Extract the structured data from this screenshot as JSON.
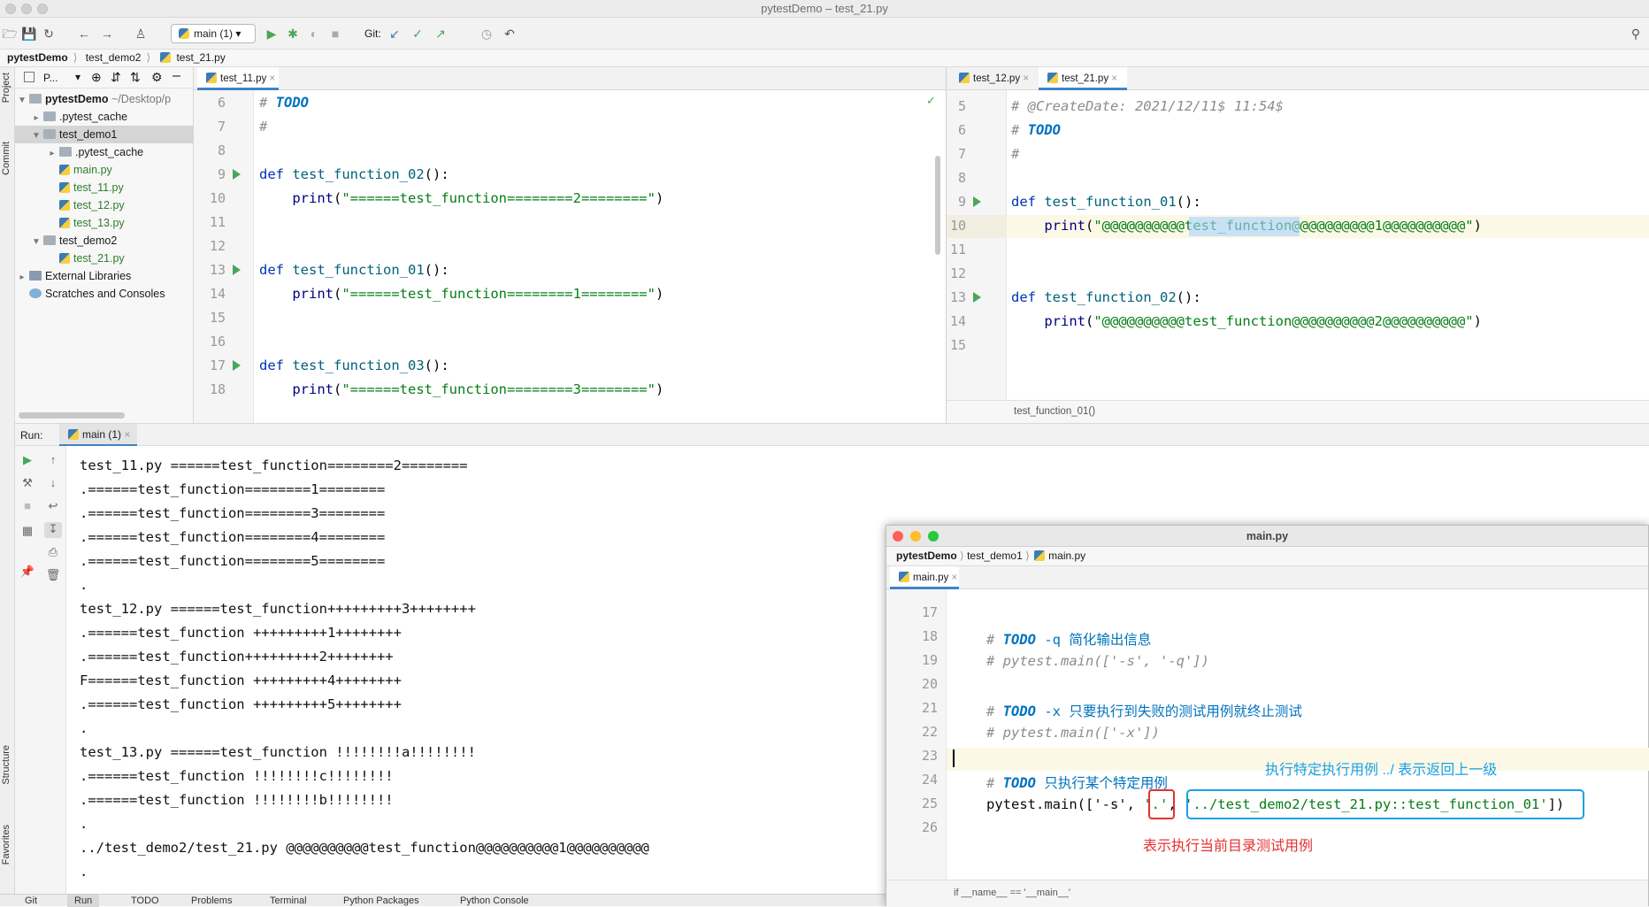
{
  "window": {
    "title": "pytestDemo – test_21.py"
  },
  "toolbar": {
    "run_config": "main (1)",
    "git_label": "Git:"
  },
  "breadcrumb": [
    "pytestDemo",
    "test_demo2",
    "test_21.py"
  ],
  "left_strip": {
    "project": "Project",
    "commit": "Commit",
    "structure": "Structure",
    "favorites": "Favorites"
  },
  "project": {
    "header": "P...",
    "tree": [
      {
        "label": "pytestDemo",
        "suffix": "~/Desktop/p",
        "kind": "folder-root"
      },
      {
        "label": ".pytest_cache",
        "kind": "folder"
      },
      {
        "label": "test_demo1",
        "kind": "folder"
      },
      {
        "label": ".pytest_cache",
        "kind": "folder"
      },
      {
        "label": "main.py",
        "kind": "py"
      },
      {
        "label": "test_11.py",
        "kind": "py"
      },
      {
        "label": "test_12.py",
        "kind": "py"
      },
      {
        "label": "test_13.py",
        "kind": "py"
      },
      {
        "label": "test_demo2",
        "kind": "folder"
      },
      {
        "label": "test_21.py",
        "kind": "py"
      },
      {
        "label": "External Libraries",
        "kind": "lib"
      },
      {
        "label": "Scratches and Consoles",
        "kind": "scratch"
      }
    ]
  },
  "editor_left": {
    "tab": "test_11.py",
    "line_numbers": [
      "6",
      "7",
      "8",
      "9",
      "10",
      "11",
      "12",
      "13",
      "14",
      "15",
      "16",
      "17",
      "18"
    ],
    "lines": [
      "# TODO",
      "#",
      "",
      "def test_function_02():",
      "    print(\"======test_function========2========\")",
      "",
      "",
      "def test_function_01():",
      "    print(\"======test_function========1========\")",
      "",
      "",
      "def test_function_03():",
      "    print(\"======test_function========3========\")"
    ]
  },
  "editor_right": {
    "tabs": [
      "test_12.py",
      "test_21.py"
    ],
    "line_numbers": [
      "5",
      "6",
      "7",
      "8",
      "9",
      "10",
      "11",
      "12",
      "13",
      "14",
      "15"
    ],
    "lines": [
      "# @CreateDate: 2021/12/11$ 11:54$",
      "# TODO",
      "#",
      "",
      "def test_function_01():",
      "    print(\"@@@@@@@@@@test_function@@@@@@@@@@1@@@@@@@@@@\")",
      "",
      "",
      "def test_function_02():",
      "    print(\"@@@@@@@@@@test_function@@@@@@@@@@2@@@@@@@@@@\")",
      ""
    ],
    "breadcrumb": "test_function_01()"
  },
  "run": {
    "label": "Run:",
    "tab": "main (1)",
    "output": [
      "test_11.py ======test_function========2========",
      ".======test_function========1========",
      ".======test_function========3========",
      ".======test_function========4========",
      ".======test_function========5========",
      ".",
      "test_12.py ======test_function+++++++++3++++++++",
      ".======test_function +++++++++1++++++++",
      ".======test_function+++++++++2++++++++",
      "F======test_function +++++++++4++++++++",
      ".======test_function +++++++++5++++++++",
      ".",
      "test_13.py ======test_function !!!!!!!!a!!!!!!!!",
      ".======test_function !!!!!!!!c!!!!!!!!",
      ".======test_function !!!!!!!!b!!!!!!!!",
      ".",
      "../test_demo2/test_21.py @@@@@@@@@@test_function@@@@@@@@@@1@@@@@@@@@@",
      "."
    ]
  },
  "bottom_tabs": [
    "Git",
    "Run",
    "TODO",
    "Problems",
    "Terminal",
    "Python Packages",
    "Python Console"
  ],
  "float_window": {
    "title": "main.py",
    "breadcrumb": [
      "pytestDemo",
      "test_demo1",
      "main.py"
    ],
    "tab": "main.py",
    "line_numbers": [
      "17",
      "18",
      "19",
      "20",
      "21",
      "22",
      "23",
      "24",
      "25",
      "26"
    ],
    "code": {
      "l18_todo": "TODO",
      "l18_rest": " -q 简化输出信息",
      "l19": "# pytest.main(['-s', '-q'])",
      "l21_todo": "TODO",
      "l21_rest": " -x 只要执行到失败的测试用例就终止测试",
      "l22": "# pytest.main(['-x'])",
      "l24_todo": "TODO",
      "l24_rest": " 只执行某个特定用例",
      "l25_a": "pytest.main(['-s', ",
      "l25_b": "'.'",
      "l25_c": ", ",
      "l25_d": "'../test_demo2/test_21.py::test_function_01'",
      "l25_e": "])"
    },
    "annotation_blue": "执行特定执行用例 ../ 表示返回上一级",
    "annotation_red": "表示执行当前目录测试用例",
    "status": "if __name__ == '__main__'"
  },
  "colors": {
    "accent": "#4083c9",
    "run_green": "#4aa65a",
    "annotation_blue": "#1aa0e8",
    "annotation_red": "#e53030"
  }
}
